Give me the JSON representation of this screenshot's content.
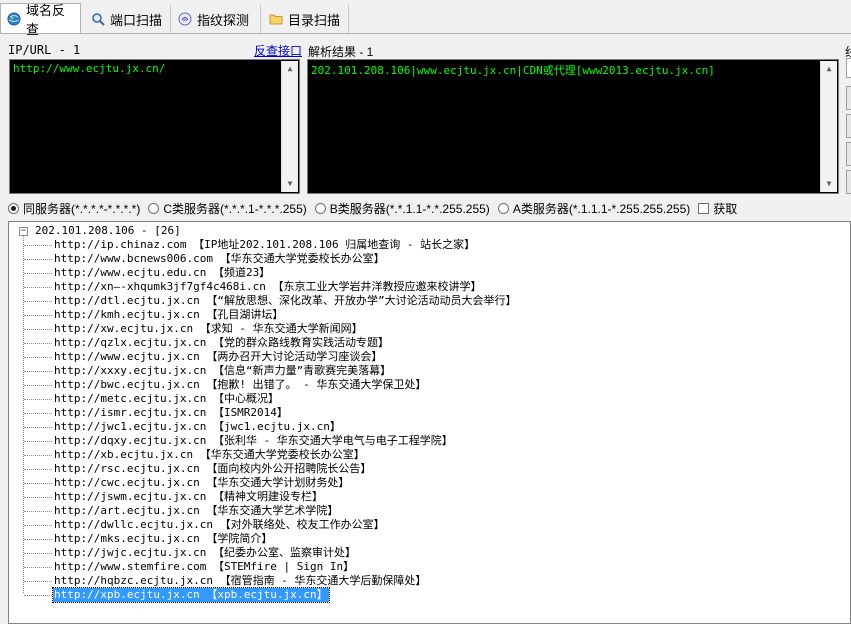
{
  "tabs": [
    {
      "label": "域名反查",
      "icon": "globe-icon",
      "active": true
    },
    {
      "label": "端口扫描",
      "icon": "magnifier-icon",
      "active": false
    },
    {
      "label": "指纹探测",
      "icon": "fingerprint-icon",
      "active": false
    },
    {
      "label": "目录扫描",
      "icon": "folder-icon",
      "active": false
    }
  ],
  "left_panel": {
    "label": "IP/URL - 1",
    "link": "反查接口",
    "content": "http://www.ecjtu.jx.cn/"
  },
  "right_panel": {
    "label": "解析结果 - 1",
    "content": "202.101.208.106|www.ecjtu.jx.cn|CDN或代理[www2013.ecjtu.jx.cn]",
    "clipped_label": "线"
  },
  "radio_options": [
    {
      "label": "同服务器(*.*.*.*-*.*.*.*)",
      "checked": true
    },
    {
      "label": "C类服务器(*.*.*.1-*.*.*.255)",
      "checked": false
    },
    {
      "label": "B类服务器(*.*.1.1-*.*.255.255)",
      "checked": false
    },
    {
      "label": "A类服务器(*.1.1.1-*.255.255.255)",
      "checked": false
    }
  ],
  "checkbox": {
    "label": "获取",
    "checked": false
  },
  "tree": {
    "root": "202.101.208.106 - [26]",
    "expander": "−",
    "selected_index": 26,
    "items": [
      "http://ip.chinaz.com 【IP地址202.101.208.106 归属地查询 - 站长之家】",
      "http://www.bcnews006.com 【华东交通大学党委校长办公室】",
      "http://www.ecjtu.edu.cn 【频道23】",
      "http://xn—-xhqumk3jf7gf4c468i.cn 【东京工业大学岩井洋教授应邀来校讲学】",
      "http://dtl.ecjtu.jx.cn 【“解放思想、深化改革、开放办学”大讨论活动动员大会举行】",
      "http://kmh.ecjtu.jx.cn 【孔目湖讲坛】",
      "http://xw.ecjtu.jx.cn 【求知 - 华东交通大学新闻网】",
      "http://qzlx.ecjtu.jx.cn 【党的群众路线教育实践活动专题】",
      "http://www.ecjtu.jx.cn 【两办召开大讨论活动学习座谈会】",
      "http://xxxy.ecjtu.jx.cn 【信息“新声力量”青歌赛完美落幕】",
      "http://bwc.ecjtu.jx.cn 【抱歉! 出错了。 - 华东交通大学保卫处】",
      "http://metc.ecjtu.jx.cn 【中心概况】",
      "http://ismr.ecjtu.jx.cn 【ISMR2014】",
      "http://jwc1.ecjtu.jx.cn 【jwc1.ecjtu.jx.cn】",
      "http://dqxy.ecjtu.jx.cn 【张利华 - 华东交通大学电气与电子工程学院】",
      "http://xb.ecjtu.jx.cn 【华东交通大学党委校长办公室】",
      "http://rsc.ecjtu.jx.cn 【面向校内外公开招聘院长公告】",
      "http://cwc.ecjtu.jx.cn 【华东交通大学计划财务处】",
      "http://jswm.ecjtu.jx.cn 【精神文明建设专栏】",
      "http://art.ecjtu.jx.cn 【华东交通大学艺术学院】",
      "http://dwllc.ecjtu.jx.cn 【对外联络处、校友工作办公室】",
      "http://mks.ecjtu.jx.cn 【学院简介】",
      "http://jwjc.ecjtu.jx.cn 【纪委办公室、监察审计处】",
      "http://www.stemfire.com 【STEMfire | Sign In】",
      "http://hqbzc.ecjtu.jx.cn 【宿管指南 - 华东交通大学后勤保障处】",
      "http://xpb.ecjtu.jx.cn 【xpb.ecjtu.jx.cn】"
    ]
  },
  "colors": {
    "console_bg": "#000000",
    "console_text": "#00ff00",
    "link": "#0000d0",
    "selection": "#3399ff"
  }
}
